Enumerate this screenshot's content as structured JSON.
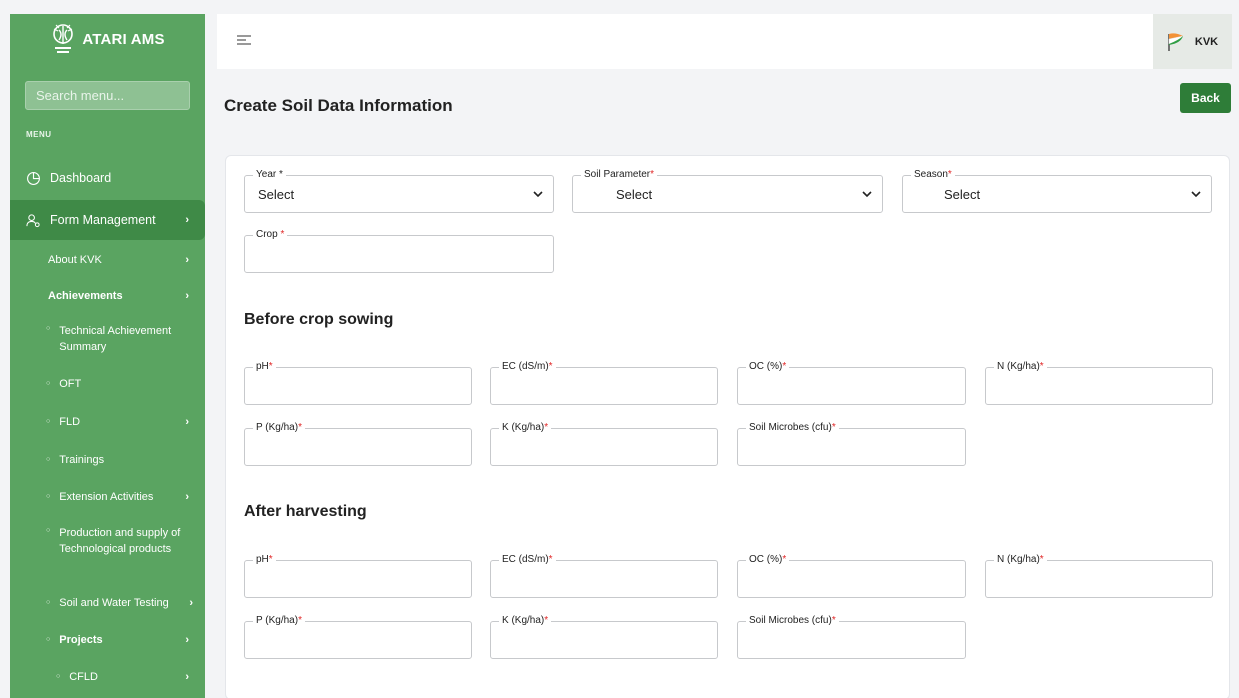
{
  "sidebar": {
    "brand": "ATARI AMS",
    "search_placeholder": "Search menu...",
    "menu_heading": "MENU",
    "items": {
      "dashboard": "Dashboard",
      "form_management": "Form Management",
      "about_kvk": "About KVK",
      "achievements": "Achievements",
      "technical_achievement_summary": "Technical Achievement Summary",
      "oft": "OFT",
      "fld": "FLD",
      "trainings": "Trainings",
      "extension_activities": "Extension Activities",
      "production_supply": "Production and supply of Technological products",
      "soil_water_testing": "Soil and Water Testing",
      "projects": "Projects",
      "cfld": "CFLD"
    }
  },
  "topbar": {
    "user_label": "KVK"
  },
  "page": {
    "title": "Create Soil Data Information",
    "back_label": "Back"
  },
  "form": {
    "year": {
      "label": "Year *",
      "value": "Select"
    },
    "soil_parameter": {
      "label": "Soil Parameter",
      "value": "Select"
    },
    "season": {
      "label": "Season",
      "value": "Select"
    },
    "crop": {
      "label": "Crop ",
      "value": ""
    },
    "required_mark": "*",
    "before": {
      "title": "Before crop sowing",
      "ph": "pH",
      "ec": "EC (dS/m)",
      "oc": "OC (%)",
      "n": "N (Kg/ha)",
      "p": "P (Kg/ha)",
      "k": "K (Kg/ha)",
      "microbes": "Soil Microbes (cfu)"
    },
    "after": {
      "title": "After harvesting",
      "ph": "pH",
      "ec": "EC (dS/m)",
      "oc": "OC (%)",
      "n": "N (Kg/ha)",
      "p": "P (Kg/ha)",
      "k": "K (Kg/ha)",
      "microbes": "Soil Microbes (cfu)"
    }
  },
  "colors": {
    "sidebar": "#5aa461",
    "sidebar_active": "#3f8a47",
    "primary_button": "#2e7d38",
    "required": "#e02424"
  }
}
